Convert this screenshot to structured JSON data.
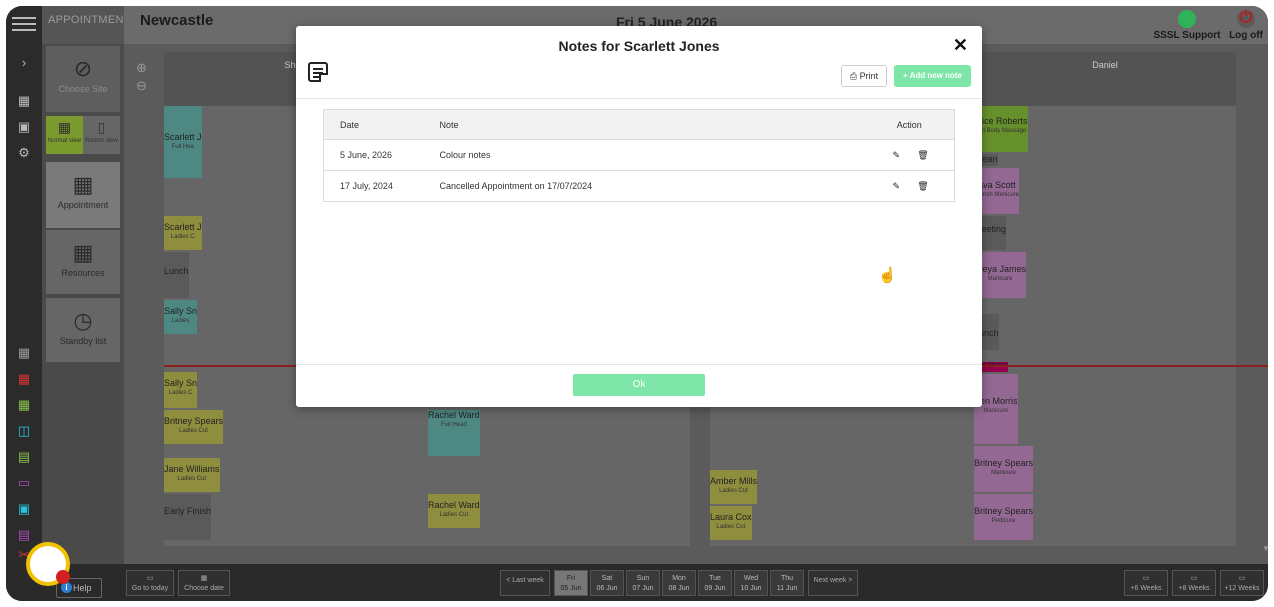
{
  "header": {
    "section": "APPOINTMENTS",
    "site": "Newcastle",
    "date_title": "Fri 5 June 2026",
    "support_label": "SSSL Support",
    "logoff_label": "Log off",
    "support_color": "#2fb35a",
    "logoff_color": "#c01818"
  },
  "sidepanel": {
    "choose_site": "Choose Site",
    "normal_view": "Normal view",
    "rooms_view": "Rooms view",
    "appointment": "Appointment",
    "resources": "Resources",
    "standby": "Standby list"
  },
  "calendar": {
    "staff": [
      "Shelb",
      "Daniel"
    ],
    "appointments_left": [
      {
        "name": "Scarlett J",
        "service": "Full Hea"
      },
      {
        "name": "Scarlett J",
        "service": "Ladies C"
      },
      {
        "name": "Lunch",
        "service": ""
      },
      {
        "name": "Sally Sn",
        "service": "Ladies"
      },
      {
        "name": "Sally Sn",
        "service": "Ladies C"
      },
      {
        "name": "Britney Spears",
        "service": "Ladies Cut"
      },
      {
        "name": "Jane Williams",
        "service": "Ladies Cut"
      },
      {
        "name": "Early Finish",
        "service": ""
      }
    ],
    "appointments_mid": [
      {
        "name": "Rachel Ward",
        "service": "Full Head"
      },
      {
        "name": "Rachel Ward",
        "service": "Ladies Cut"
      },
      {
        "name": "Amber Mills",
        "service": "Ladies Cut"
      },
      {
        "name": "Laura Cox",
        "service": "Ladies Cut"
      }
    ],
    "appointments_right": [
      {
        "name": "Alice Roberts",
        "service": "Full Body Massage"
      },
      {
        "name": "Clean",
        "service": ""
      },
      {
        "name": "Ava Scott",
        "service": "French Manicure"
      },
      {
        "name": "Meeting",
        "service": ""
      },
      {
        "name": "Freya James",
        "service": "Manicure"
      },
      {
        "name": "Lunch",
        "service": ""
      },
      {
        "name": "Ben Morris",
        "service": ""
      },
      {
        "name": "Ben Morris",
        "service": "Manicure"
      },
      {
        "name": "Britney Spears",
        "service": "Manicure"
      },
      {
        "name": "Britney Spears",
        "service": "Pedicure"
      }
    ]
  },
  "modal": {
    "title": "Notes for Scarlett Jones",
    "print_label": "Print",
    "add_label": "+ Add new note",
    "columns": {
      "date": "Date",
      "note": "Note",
      "action": "Action"
    },
    "rows": [
      {
        "date": "5 June, 2026",
        "note": "Colour notes"
      },
      {
        "date": "17 July, 2024",
        "note": "Cancelled Appointment on 17/07/2024"
      }
    ],
    "ok_label": "Ok",
    "accent_color": "#7ee6a8"
  },
  "bottom": {
    "help": "Help",
    "go_today": "Go to today",
    "choose_date": "Choose date",
    "last_week": "< Last week",
    "next_week": "Next week >",
    "days": [
      {
        "dow": "Fri",
        "date": "05 Jun"
      },
      {
        "dow": "Sat",
        "date": "06 Jun"
      },
      {
        "dow": "Sun",
        "date": "07 Jun"
      },
      {
        "dow": "Mon",
        "date": "08 Jun"
      },
      {
        "dow": "Tue",
        "date": "09 Jun"
      },
      {
        "dow": "Wed",
        "date": "10 Jun"
      },
      {
        "dow": "Thu",
        "date": "11 Jun"
      }
    ],
    "weeks": [
      "+6 Weeks",
      "+8 Weeks",
      "+12 Weeks"
    ]
  }
}
